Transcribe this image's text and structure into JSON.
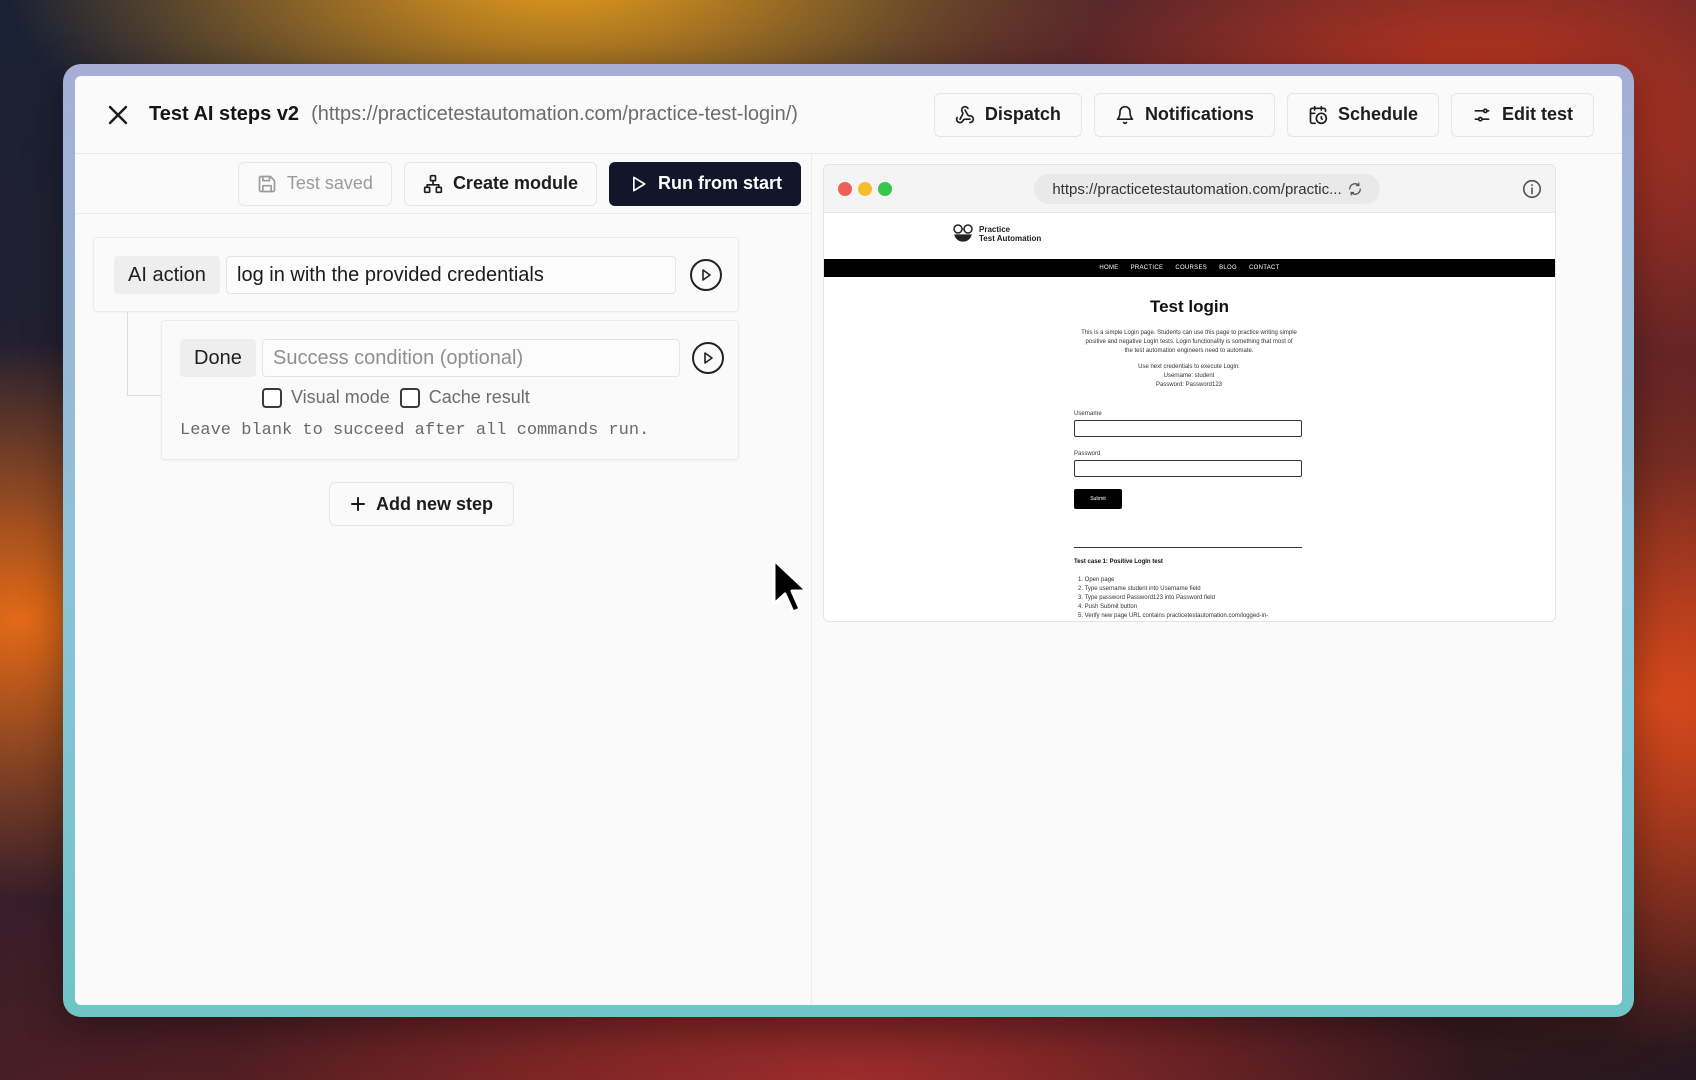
{
  "header": {
    "title": "Test AI steps v2",
    "url": "(https://practicetestautomation.com/practice-test-login/)",
    "actions": {
      "dispatch": "Dispatch",
      "notifications": "Notifications",
      "schedule": "Schedule",
      "edit_test": "Edit test"
    }
  },
  "toolbar": {
    "saved_label": "Test saved",
    "create_module_label": "Create module",
    "run_label": "Run from start"
  },
  "steps": [
    {
      "type": "AI action",
      "value": "log in with the provided credentials"
    }
  ],
  "done": {
    "type": "Done",
    "placeholder": "Success condition (optional)",
    "visual_mode_label": "Visual mode",
    "cache_result_label": "Cache result",
    "hint": "Leave blank to succeed after all commands run."
  },
  "add_step_label": "Add new step",
  "preview": {
    "url": "https://practicetestautomation.com/practic...",
    "site": {
      "logo_line1": "Practice",
      "logo_line2": "Test Automation",
      "nav": [
        "HOME",
        "PRACTICE",
        "COURSES",
        "BLOG",
        "CONTACT"
      ],
      "heading": "Test login",
      "intro_1": "This is a simple Login page. Students can use this page to practice writing simple",
      "intro_2": "positive and negative LogIn tests. Login functionality is something that most of",
      "intro_3": "the test automation engineers need to automate.",
      "creds_1": "Use next credentials to execute Login:",
      "creds_2": "Username: student",
      "creds_3": "Password: Password123",
      "username_label": "Username",
      "password_label": "Password",
      "submit_label": "Submit",
      "testcase_heading": "Test case 1: Positive LogIn test",
      "testcase_steps": [
        "1. Open page",
        "2. Type username student into Username field",
        "3. Type password Password123 into Password field",
        "4. Push Submit button",
        "5. Verify new page URL contains practicetestautomation.com/logged-in-"
      ]
    }
  },
  "colors": {
    "primary_button": "#12162a",
    "traffic_red": "#ef5f57",
    "traffic_yellow": "#f6bd2f",
    "traffic_green": "#36c84a"
  }
}
